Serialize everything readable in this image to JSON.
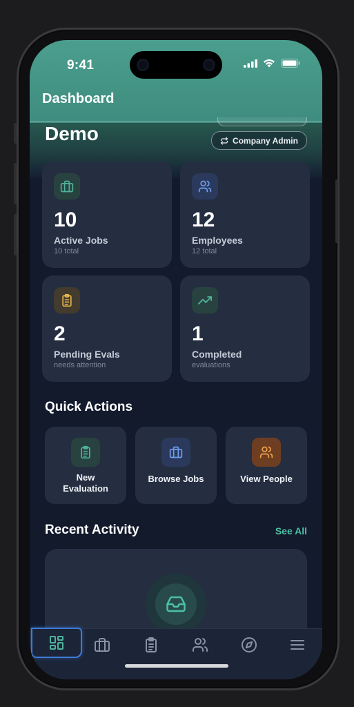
{
  "status_bar": {
    "time": "9:41"
  },
  "nav": {
    "title": "Dashboard"
  },
  "hero": {
    "title": "Demo",
    "role_label": "Company Admin",
    "role_icon": "swap-icon"
  },
  "stats": [
    {
      "icon": "briefcase-icon",
      "value": "10",
      "label": "Active Jobs",
      "sub": "10 total",
      "color": "#4fb39d"
    },
    {
      "icon": "users-icon",
      "value": "12",
      "label": "Employees",
      "sub": "12 total",
      "color": "#6f9ef0"
    },
    {
      "icon": "clipboard-icon",
      "value": "2",
      "label": "Pending Evals",
      "sub": "needs attention",
      "color": "#e3b54d"
    },
    {
      "icon": "trending-up-icon",
      "value": "1",
      "label": "Completed",
      "sub": "evaluations",
      "color": "#4fb39d"
    }
  ],
  "quick_actions": {
    "title": "Quick Actions",
    "items": [
      {
        "icon": "clipboard-icon",
        "label_line1": "New",
        "label_line2": "Evaluation",
        "color": "#4fb39d"
      },
      {
        "icon": "briefcase-icon",
        "label_line1": "Browse Jobs",
        "label_line2": "",
        "color": "#6f9ef0"
      },
      {
        "icon": "users-icon",
        "label_line1": "View People",
        "label_line2": "",
        "color": "#f0a24a"
      }
    ]
  },
  "recent_activity": {
    "title": "Recent Activity",
    "see_all": "See All",
    "empty_icon": "inbox-icon"
  },
  "tab_bar": {
    "items": [
      {
        "icon": "dashboard-icon",
        "active": true
      },
      {
        "icon": "briefcase-icon",
        "active": false
      },
      {
        "icon": "clipboard-icon",
        "active": false
      },
      {
        "icon": "users-icon",
        "active": false
      },
      {
        "icon": "compass-icon",
        "active": false
      },
      {
        "icon": "menu-icon",
        "active": false
      }
    ]
  },
  "colors": {
    "accent": "#4cc0a6",
    "header": "#4b9e8d",
    "background": "#121a2c",
    "card": "#252e41"
  }
}
